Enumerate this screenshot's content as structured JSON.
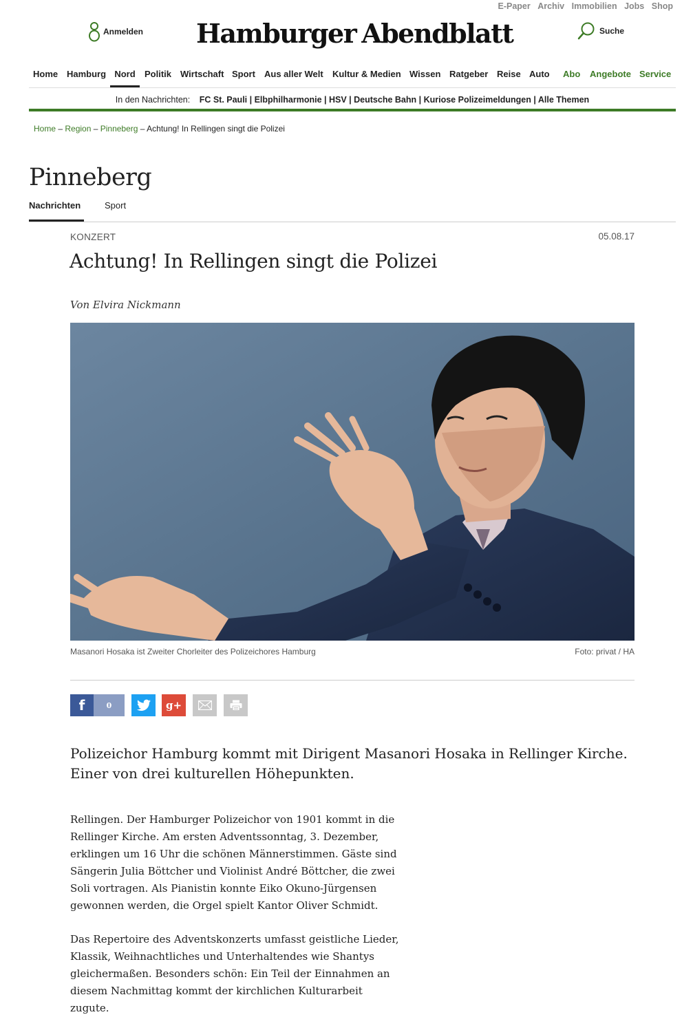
{
  "util_links": [
    "E-Paper",
    "Archiv",
    "Immobilien",
    "Jobs",
    "Shop"
  ],
  "header": {
    "login_label": "Anmelden",
    "logo_word1": "Hamburger",
    "logo_word2": "Abendblatt",
    "search_label": "Suche"
  },
  "nav": {
    "items": [
      "Home",
      "Hamburg",
      "Nord",
      "Politik",
      "Wirtschaft",
      "Sport",
      "Aus aller Welt",
      "Kultur & Medien",
      "Wissen",
      "Ratgeber",
      "Reise",
      "Auto",
      "Abo",
      "Angebote",
      "Service"
    ],
    "active": "Nord",
    "accent_color": "#3d7b26"
  },
  "news_bar": {
    "label": "In den Nachrichten:",
    "topics": [
      "FC St. Pauli",
      "Elbphilharmonie",
      "HSV",
      "Deutsche Bahn",
      "Kuriose Polizeimeldungen",
      "Alle Themen"
    ]
  },
  "breadcrumb": [
    "Home",
    "Region",
    "Pinneberg",
    "Achtung! In Rellingen singt die Polizei"
  ],
  "section": {
    "title": "Pinneberg",
    "tabs": [
      "Nachrichten",
      "Sport"
    ],
    "active_tab": "Nachrichten"
  },
  "article": {
    "kicker": "KONZERT",
    "date": "05.08.17",
    "headline": "Achtung! In Rellingen singt die Polizei",
    "author": "Von Elvira Nickmann",
    "caption": "Masanori Hosaka ist Zweiter Chorleiter des Polizeichores Hamburg",
    "credit": "Foto: privat / HA",
    "lead": "Polizeichor Hamburg kommt mit Dirigent Masanori Hosaka in Rellinger Kirche. Einer von drei kulturellen Höhepunkten.",
    "paragraphs": [
      "Rellingen.  Der Hamburger Polizeichor von 1901 kommt in die Rellinger Kirche. Am ersten Adventssonntag, 3. Dezember, erklingen um 16 Uhr die schönen Männerstimmen. Gäste sind Sängerin Julia Böttcher und Violinist André Böttcher, die zwei Soli vortragen. Als Pianistin konnte Eiko Okuno-Jürgensen gewonnen werden, die Orgel spielt Kantor Oliver Schmidt.",
      "Das Repertoire des Adventskonzerts umfasst geistliche Lieder, Klassik, Weihnachtliches und Unterhaltendes wie Shantys gleichermaßen. Besonders schön: Ein Teil der Einnahmen an diesem Nachmittag kommt der kirchlichen Kulturarbeit zugute."
    ]
  },
  "share": {
    "facebook_icon": "f",
    "facebook_count": "0",
    "gplus_icon": "g+"
  }
}
